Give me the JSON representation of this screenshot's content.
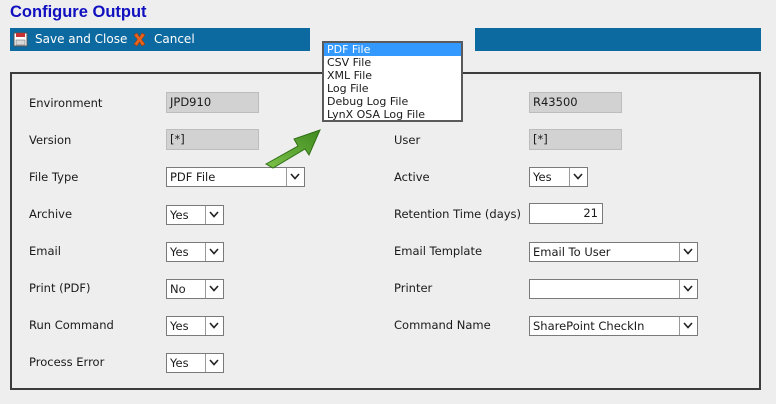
{
  "page": {
    "title": "Configure Output"
  },
  "toolbar": {
    "save_label": "Save and Close",
    "cancel_label": "Cancel"
  },
  "dropdown": {
    "options": [
      "PDF File",
      "CSV File",
      "XML File",
      "Log File",
      "Debug Log File",
      "LynX OSA Log File"
    ],
    "selected_index": 0
  },
  "form": {
    "environment": {
      "label": "Environment",
      "value": "JPD910"
    },
    "program": {
      "value": "R43500"
    },
    "version": {
      "label": "Version",
      "value": "[*]"
    },
    "user": {
      "label": "User",
      "value": "[*]"
    },
    "file_type": {
      "label": "File Type",
      "value": "PDF File"
    },
    "active": {
      "label": "Active",
      "value": "Yes"
    },
    "archive": {
      "label": "Archive",
      "value": "Yes"
    },
    "retention": {
      "label": "Retention Time (days)",
      "value": "21"
    },
    "email": {
      "label": "Email",
      "value": "Yes"
    },
    "email_template": {
      "label": "Email Template",
      "value": "Email To User"
    },
    "print_pdf": {
      "label": "Print (PDF)",
      "value": "No"
    },
    "printer": {
      "label": "Printer",
      "value": ""
    },
    "run_command": {
      "label": "Run Command",
      "value": "Yes"
    },
    "command_name": {
      "label": "Command Name",
      "value": "SharePoint CheckIn"
    },
    "process_error": {
      "label": "Process Error",
      "value": "Yes"
    }
  },
  "colors": {
    "title": "#1010c0",
    "toolbar": "#0c6aa0",
    "highlight": "#3399ff",
    "callout_arrow": "#5aa02c"
  }
}
